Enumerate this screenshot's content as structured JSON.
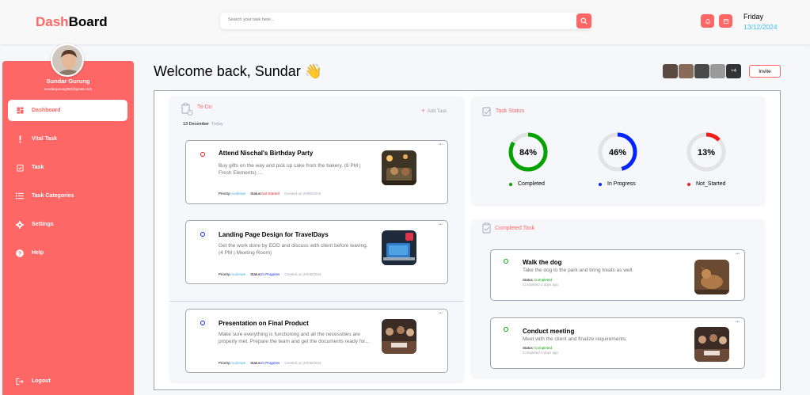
{
  "header": {
    "logo_part1": "Dash",
    "logo_part2": "Board",
    "search_placeholder": "Search your task here...",
    "day": "Friday",
    "date": "13/12/2024"
  },
  "user": {
    "name": "Sundar Gurung",
    "email": "sundargurung360@gmail.com"
  },
  "nav": [
    {
      "label": "Dashboard",
      "icon": "grid-icon",
      "active": true
    },
    {
      "label": "Vital Task",
      "icon": "exclamation-icon"
    },
    {
      "label": "Task",
      "icon": "checklist-icon"
    },
    {
      "label": "Task Categories",
      "icon": "list-icon"
    },
    {
      "label": "Settings",
      "icon": "gear-icon"
    },
    {
      "label": "Help",
      "icon": "help-icon"
    }
  ],
  "logout_label": "Logout",
  "welcome": "Welcome back, Sundar 👋",
  "team_more": "+4",
  "invite_label": "Invite",
  "todo": {
    "title": "To-Do",
    "add_label": "Add Task",
    "date": "13 December",
    "today": "Today",
    "tasks": [
      {
        "title": "Attend Nischal's Birthday Party",
        "desc": "Buy gifts on the way and pick up cake from the bakery. (6 PM | Fresh Elements).....",
        "priority_label": "Priority:",
        "priority": "moderate",
        "status_label": "Status:",
        "status": "Not Started",
        "created": "Created on:20/06/2023",
        "more": "•••"
      },
      {
        "title": "Landing Page Design for TravelDays",
        "desc": "Get the work done by EOD and discuss with client before leaving. (4 PM | Meeting Room)",
        "priority_label": "Priority:",
        "priority": "moderate",
        "status_label": "Status:",
        "status": "In Progress",
        "created": "Created on:20/06/2023",
        "more": "•••"
      },
      {
        "title": "Presentation on Final Product",
        "desc": "Make sure everything is functioning and all the necessities are properly met. Prepare the team and get the documents ready for...",
        "priority_label": "Priority:",
        "priority": "moderate",
        "status_label": "Status:",
        "status": "In Progress",
        "created": "Created on:20/06/2023",
        "more": "•••"
      }
    ]
  },
  "task_status": {
    "title": "Task Status",
    "items": [
      {
        "value": "84%",
        "label": "Completed",
        "fraction": 0.84,
        "color": "#05a301"
      },
      {
        "value": "46%",
        "label": "In Progress",
        "fraction": 0.46,
        "color": "#0225ff"
      },
      {
        "value": "13%",
        "label": "Not_Started",
        "fraction": 0.13,
        "color": "#f21e1e"
      }
    ]
  },
  "completed": {
    "title": "Completed Task",
    "tasks": [
      {
        "title": "Walk the dog",
        "desc": "Take the dog to the park and bring treats as well.",
        "status_label": "Status :",
        "status": "Completed",
        "when": "Completed 2 days ago",
        "more": "•••"
      },
      {
        "title": "Conduct meeting",
        "desc": "Meet with the client and finalize requirements.",
        "status_label": "Status :",
        "status": "Completed",
        "when": "Completed 2 days ago",
        "more": "•••"
      }
    ]
  },
  "colors": {
    "accent": "#ff6767",
    "completed": "#05a301",
    "in_progress": "#0225ff",
    "not_started": "#f21e1e",
    "date_blue": "#3abeff"
  }
}
